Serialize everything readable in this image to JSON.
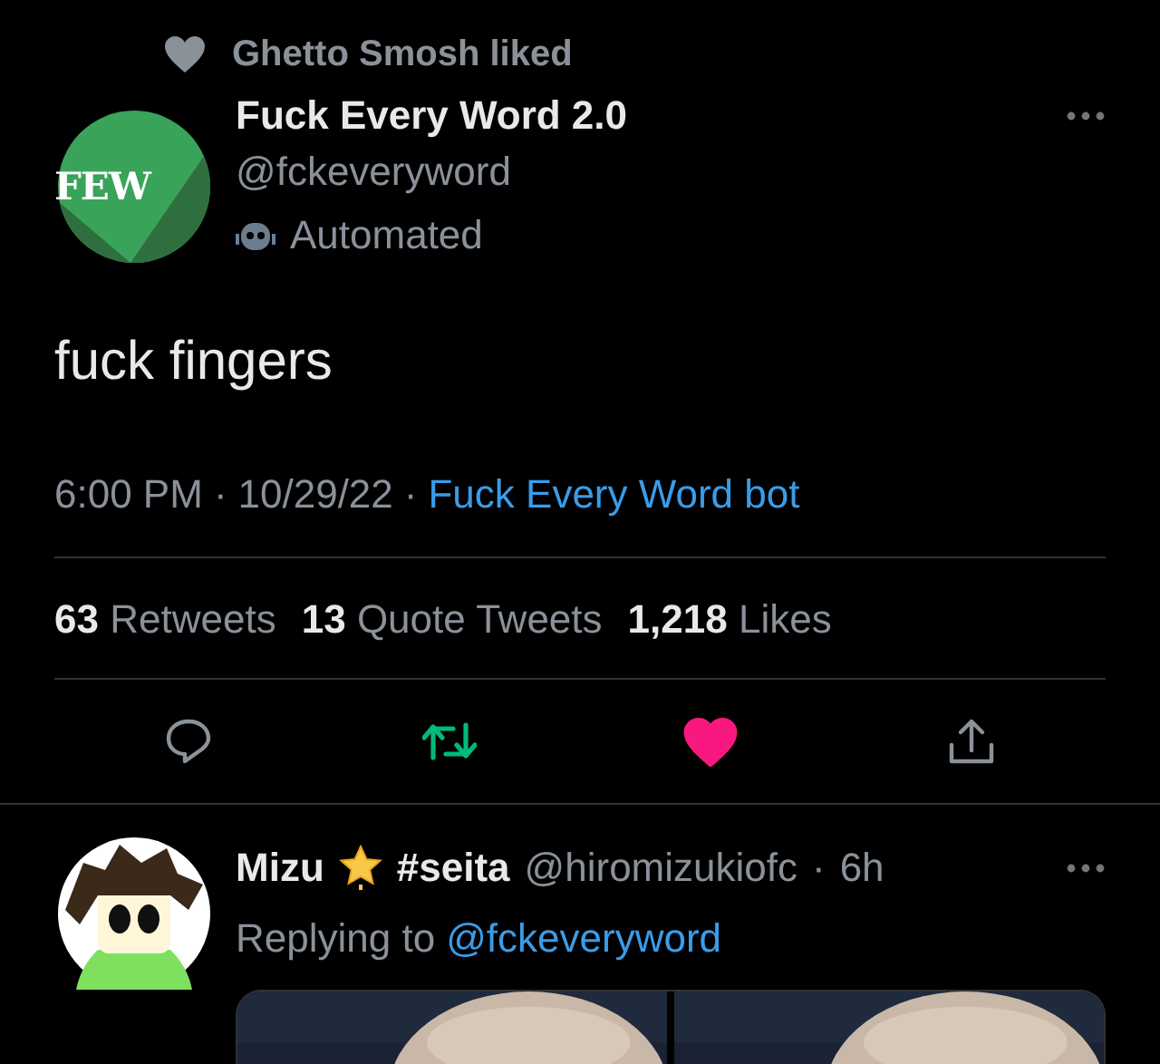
{
  "social_context": {
    "text": "Ghetto Smosh liked"
  },
  "tweet": {
    "avatar_text": "FEW",
    "name": "Fuck Every Word 2.0",
    "handle": "@fckeveryword",
    "label": "Automated",
    "text": "fuck fingers",
    "time": "6:00 PM",
    "date": "10/29/22",
    "separator": "·",
    "source": "Fuck Every Word bot",
    "stats": [
      {
        "count": "63",
        "label": "Retweets"
      },
      {
        "count": "13",
        "label": "Quote Tweets"
      },
      {
        "count": "1,218",
        "label": "Likes"
      }
    ],
    "actions": {
      "retweeted": true,
      "liked": true
    }
  },
  "reply": {
    "name": "Mizu",
    "hashtag": "#seita",
    "handle": "@hiromizukiofc",
    "time": "6h",
    "separator": "·",
    "replying_prefix": "Replying to",
    "replying_to": "@fckeveryword"
  }
}
